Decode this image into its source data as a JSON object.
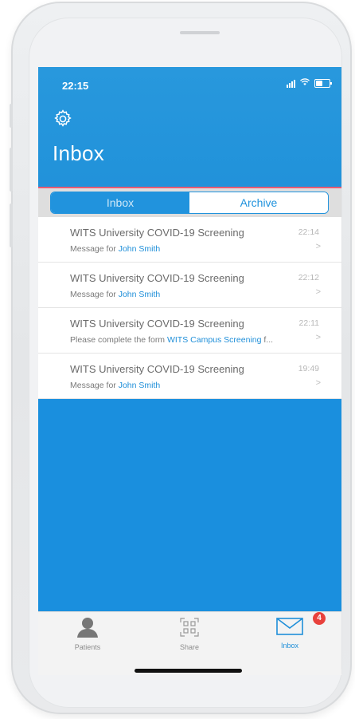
{
  "status": {
    "time": "22:15"
  },
  "header": {
    "title": "Inbox"
  },
  "segments": {
    "inbox": "Inbox",
    "archive": "Archive",
    "selected": "Inbox"
  },
  "messages": [
    {
      "title": "WITS University COVID-19 Screening",
      "time": "22:14",
      "prefix": "Message for ",
      "link": "John Smith",
      "suffix": ""
    },
    {
      "title": "WITS University COVID-19 Screening",
      "time": "22:12",
      "prefix": "Message for ",
      "link": "John Smith",
      "suffix": ""
    },
    {
      "title": "WITS University COVID-19 Screening",
      "time": "22:11",
      "prefix": "Please complete the form ",
      "link": "WITS Campus Screening",
      "suffix": "  f..."
    },
    {
      "title": "WITS University COVID-19 Screening",
      "time": "19:49",
      "prefix": "Message for ",
      "link": "John Smith",
      "suffix": ""
    }
  ],
  "tabbar": {
    "patients": "Patients",
    "share": "Share",
    "inbox": "Inbox",
    "inbox_badge": "4"
  },
  "colors": {
    "accent": "#1f8fd9",
    "header": "#2898dd",
    "badge": "#e8413c",
    "divider": "#e75c73"
  }
}
